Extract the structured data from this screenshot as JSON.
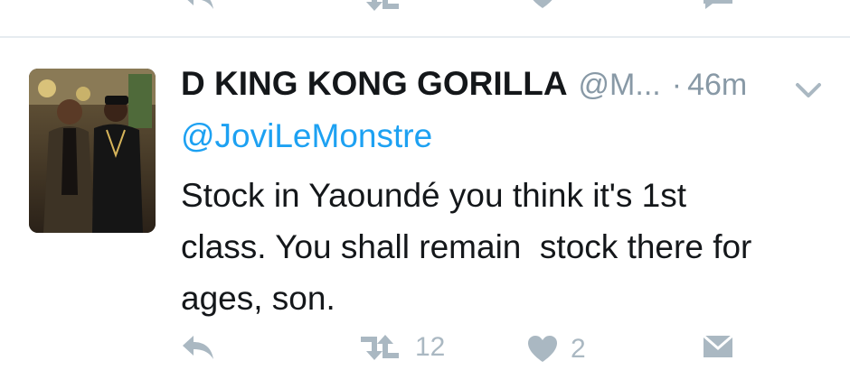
{
  "tweet": {
    "display_name": "D KING KONG GORILLA",
    "handle": "@M...",
    "separator": "·",
    "time": "46m",
    "mention": "@JoviLeMonstre",
    "text": "Stock in Yaoundé you think it's 1st\nclass. You shall remain  stock there for\nages, son.",
    "retweet_count": "12",
    "like_count": "2"
  },
  "colors": {
    "accent": "#1da1f2",
    "muted": "#aab8c2",
    "text": "#14171a",
    "divider": "#e6ecf0"
  },
  "icons": {
    "reply": "reply-icon",
    "retweet": "retweet-icon",
    "like": "heart-icon",
    "dm": "envelope-icon",
    "menu": "chevron-down-icon"
  }
}
